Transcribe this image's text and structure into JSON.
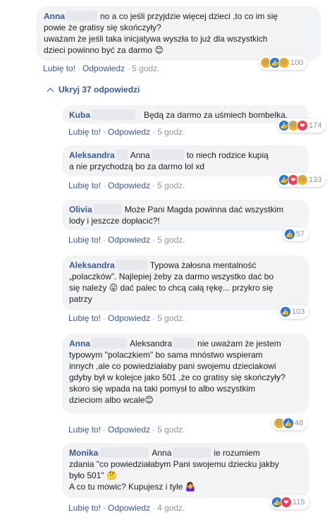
{
  "hide_replies": "Ukryj 37 odpowiedzi",
  "comments": [
    {
      "author": "Anna",
      "lines": [
        "no a co jeśli przyjdzie więcej dzieci ,to co im się",
        "powie że gratisy się skończyły?",
        "uważam że jeśli taka inicjatywa wyszła to już dla wszystkich",
        "dzieci powinno być za darmo 😊"
      ],
      "like": "Lubię to!",
      "reply": "Odpowiedz",
      "time": "5 godz.",
      "reaction_icons": [
        "haha",
        "like",
        "wow"
      ],
      "reaction_count": "100"
    },
    {
      "author": "Kuba",
      "lines": [
        "Będą za darmo za uśmiech bombelka."
      ],
      "like": "Lubię to!",
      "reply": "Odpowiedz",
      "time": "5 godz.",
      "reaction_icons": [
        "like",
        "haha",
        "love"
      ],
      "reaction_count": "174"
    },
    {
      "author": "Aleksandra",
      "mention": "Anna",
      "lines": [
        "to niech rodzice kupią",
        "a nie przychodzą bo za darmo lol xd"
      ],
      "like": "Lubię to!",
      "reply": "Odpowiedz",
      "time": "5 godz.",
      "reaction_icons": [
        "like",
        "love",
        "haha"
      ],
      "reaction_count": "133"
    },
    {
      "author": "Olivia",
      "lines": [
        "Może Pani Magda powinna dać wszystkim",
        "lody i jeszcze dopłacić?!"
      ],
      "like": "Lubię to!",
      "reply": "Odpowiedz",
      "time": "5 godz.",
      "reaction_icons": [
        "like"
      ],
      "reaction_count": "57"
    },
    {
      "author": "Aleksandra",
      "lines": [
        "Typowa żałosna mentalność",
        "„polaczków”. Najlepiej żeby za darmo wszystko dać bo",
        "się należy 😛 dać palec to chcą całą rękę... przykro się",
        "patrzy"
      ],
      "like": "Lubię to!",
      "reply": "Odpowiedz",
      "time": "5 godz.",
      "reaction_icons": [
        "like"
      ],
      "reaction_count": "103"
    },
    {
      "author": "Anna",
      "mention": "Aleksandra",
      "lines": [
        "nie uważam że jestem",
        "typowym \"polaczkiem\" bo sama mnóstwo wspieram",
        "innych ,ale co powiedziałaby pani swojemu dzieciakowi",
        "gdyby był w kolejce jako 501 ,że co gratisy się skończyły?",
        "skoro się wpada na taki pomysł to albo wszystkim",
        "dzieciom albo wcale😊"
      ],
      "like": "Lubię to!",
      "reply": "Odpowiedz",
      "time": "5 godz.",
      "reaction_icons": [
        "haha",
        "like"
      ],
      "reaction_count": "48"
    },
    {
      "author": "Monika",
      "mention": "Anna",
      "lines": [
        "ie rozumiem",
        "zdania \"co powiedziałabym Pani swojemu dziecku jakby",
        "było 501\" 🤔",
        "A co tu mowic? Kupujesz i tyle 🤷‍♀️"
      ],
      "like": "Lubię to!",
      "reply": "Odpowiedz",
      "time": "4 godz.",
      "reaction_icons": [
        "like",
        "love"
      ],
      "reaction_count": "115"
    }
  ]
}
